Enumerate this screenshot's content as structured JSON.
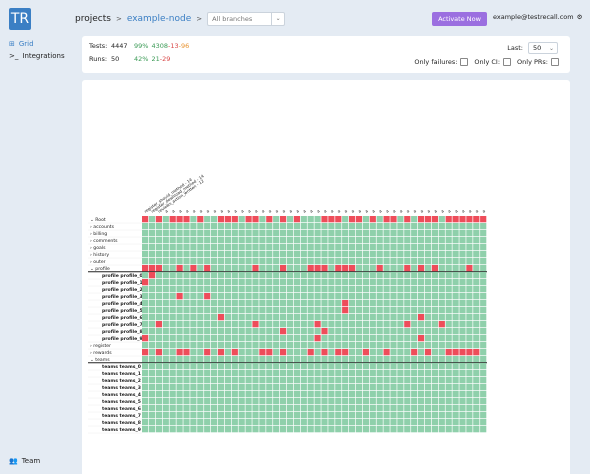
{
  "app": {
    "logo": "TR"
  },
  "sidebar": {
    "items": [
      {
        "label": "Grid",
        "icon": "grid-icon"
      },
      {
        "label": "Integrations",
        "icon": "terminal-icon"
      }
    ],
    "bottom": {
      "label": "Team",
      "icon": "team-icon"
    }
  },
  "breadcrumb": {
    "root": "projects",
    "project": "example-node",
    "separator": ">"
  },
  "branch": {
    "placeholder": "All branches"
  },
  "activate_label": "Activate Now",
  "user": {
    "email": "example@testrecall.com"
  },
  "stats": {
    "tests": {
      "label": "Tests:",
      "count": "4447",
      "pct": "99%",
      "passed": "4308",
      "failed": "13",
      "skipped": "96"
    },
    "runs": {
      "label": "Runs:",
      "count": "50",
      "pct": "42%",
      "passed": "21",
      "failed": "29"
    }
  },
  "last": {
    "label": "Last:",
    "value": "50"
  },
  "filters": [
    {
      "label": "Only failures:"
    },
    {
      "label": "Only CI:"
    },
    {
      "label": "Only PRs:"
    }
  ],
  "colors": {
    "pass": "#8fd0ab",
    "fail": "#ee4d5a",
    "accent": "#3b7fc4",
    "activate": "#9b6fe0"
  },
  "grid": {
    "columns": 50,
    "column_headers": [
      "register_should_method - 14",
      "register_download_method - 14",
      "reviews_action_written - 12",
      "a",
      "a",
      "a",
      "a",
      "a",
      "a",
      "a",
      "a",
      "a",
      "a",
      "a",
      "a",
      "a",
      "a",
      "a",
      "a",
      "a",
      "a",
      "a",
      "a",
      "a",
      "a",
      "a",
      "a",
      "a",
      "a",
      "a",
      "a",
      "a",
      "a",
      "a",
      "a",
      "a",
      "a",
      "a",
      "a",
      "a",
      "a",
      "a",
      "a",
      "a",
      "a",
      "a",
      "a",
      "a",
      "a",
      "a"
    ],
    "rows": [
      {
        "label": "Root",
        "kind": "group-open",
        "fails": [
          0,
          2,
          4,
          5,
          6,
          8,
          11,
          12,
          13,
          15,
          16,
          18,
          20,
          22,
          26,
          27,
          28,
          30,
          31,
          33,
          35,
          36,
          38,
          40,
          41,
          42,
          44,
          45,
          46,
          47,
          48,
          49
        ]
      },
      {
        "label": "accounts",
        "kind": "group",
        "fails": []
      },
      {
        "label": "billing",
        "kind": "group",
        "fails": []
      },
      {
        "label": "comments",
        "kind": "group",
        "fails": []
      },
      {
        "label": "goals",
        "kind": "group",
        "fails": []
      },
      {
        "label": "history",
        "kind": "group",
        "fails": []
      },
      {
        "label": "outer",
        "kind": "group",
        "fails": []
      },
      {
        "label": "profile",
        "kind": "group-open",
        "fails": [
          0,
          1,
          2,
          5,
          7,
          9,
          16,
          20,
          24,
          25,
          26,
          28,
          29,
          30,
          34,
          38,
          40,
          42,
          47
        ]
      },
      {
        "label": "profile profile_0",
        "kind": "leaf",
        "fails": [
          1
        ]
      },
      {
        "label": "profile profile_1",
        "kind": "leaf",
        "fails": [
          0
        ]
      },
      {
        "label": "profile profile_2",
        "kind": "leaf",
        "fails": []
      },
      {
        "label": "profile profile_3",
        "kind": "leaf",
        "fails": [
          5,
          9
        ]
      },
      {
        "label": "profile profile_4",
        "kind": "leaf",
        "fails": [
          29
        ]
      },
      {
        "label": "profile profile_5",
        "kind": "leaf",
        "fails": [
          29
        ]
      },
      {
        "label": "profile profile_6",
        "kind": "leaf",
        "fails": [
          11,
          40
        ]
      },
      {
        "label": "profile profile_7",
        "kind": "leaf",
        "fails": [
          2,
          16,
          25,
          38,
          43
        ]
      },
      {
        "label": "profile profile_8",
        "kind": "leaf",
        "fails": [
          20,
          26
        ]
      },
      {
        "label": "profile profile_9",
        "kind": "leaf",
        "fails": [
          0,
          25,
          40
        ]
      },
      {
        "label": "register",
        "kind": "group",
        "fails": []
      },
      {
        "label": "rewards",
        "kind": "group",
        "fails": [
          0,
          2,
          5,
          6,
          9,
          11,
          13,
          17,
          18,
          20,
          24,
          26,
          28,
          29,
          32,
          35,
          39,
          41,
          44,
          45,
          46,
          47,
          48
        ]
      },
      {
        "label": "teams",
        "kind": "group-open",
        "fails": []
      },
      {
        "label": "teams teams_0",
        "kind": "leaf",
        "fails": []
      },
      {
        "label": "teams teams_1",
        "kind": "leaf",
        "fails": []
      },
      {
        "label": "teams teams_2",
        "kind": "leaf",
        "fails": []
      },
      {
        "label": "teams teams_3",
        "kind": "leaf",
        "fails": []
      },
      {
        "label": "teams teams_4",
        "kind": "leaf",
        "fails": []
      },
      {
        "label": "teams teams_5",
        "kind": "leaf",
        "fails": []
      },
      {
        "label": "teams teams_6",
        "kind": "leaf",
        "fails": []
      },
      {
        "label": "teams teams_7",
        "kind": "leaf",
        "fails": []
      },
      {
        "label": "teams teams_8",
        "kind": "leaf",
        "fails": []
      },
      {
        "label": "teams teams_9",
        "kind": "leaf",
        "fails": []
      }
    ]
  }
}
